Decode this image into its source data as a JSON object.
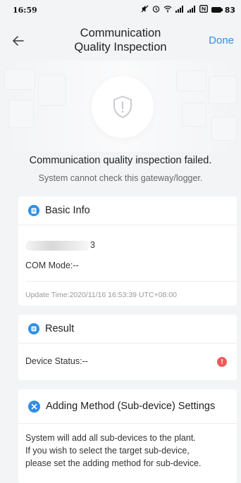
{
  "status_bar": {
    "time": "16:59",
    "battery": "83"
  },
  "nav": {
    "title_line1": "Communication",
    "title_line2": "Quality Inspection",
    "done_label": "Done"
  },
  "result_banner": {
    "title": "Communication quality inspection failed.",
    "subtitle": "System cannot check this gateway/logger."
  },
  "basic_info": {
    "header": "Basic Info",
    "device_sn_suffix": "3",
    "com_mode": "COM Mode:--",
    "update_time": "Update Time:2020/11/16 16:53:39 UTC+08:00"
  },
  "result": {
    "header": "Result",
    "device_status": "Device Status:--"
  },
  "adding_method": {
    "header": "Adding Method (Sub-device) Settings",
    "line1": "System will add all sub-devices to the plant.",
    "line2": "If you wish to select the target sub-device,",
    "line3": "please set the adding method for sub-device."
  },
  "colors": {
    "accent": "#2f8ee6",
    "alert": "#f0595b",
    "background": "#f3f4f6"
  }
}
